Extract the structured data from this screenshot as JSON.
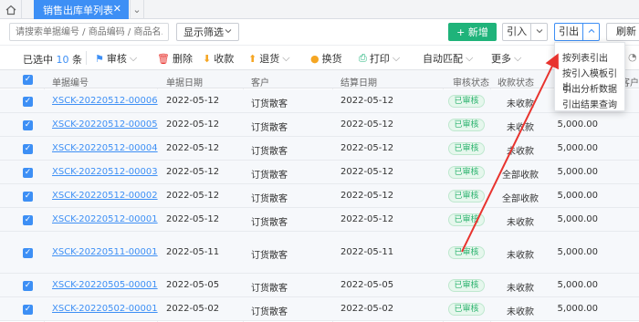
{
  "tabbar": {
    "tab_label": "销售出库单列表",
    "close": "✕",
    "more": "⌄"
  },
  "search": {
    "placeholder": "请搜索单据编号 / 商品编码 / 商品名..."
  },
  "toolbar": {
    "filter": "显示筛选",
    "new": "+ 新增",
    "import": "引入",
    "export": "引出",
    "refresh": "刷新"
  },
  "actions": {
    "selected_prefix": "已选中",
    "selected_count": "10",
    "selected_suffix": "条",
    "audit": "审核",
    "delete": "删除",
    "collect": "收款",
    "return": "退货",
    "exchange": "换货",
    "print": "打印",
    "auto_match": "自动匹配",
    "more": "更多"
  },
  "columns": [
    "单据编号",
    "单据日期",
    "客户",
    "结算日期",
    "审核状态",
    "收款状态",
    "客户"
  ],
  "rows": [
    {
      "no": "XSCK-20220512-00006",
      "date": "2022-05-12",
      "customer": "订货散客",
      "settle": "2022-05-12",
      "audit": "已审核",
      "pay": "未收款",
      "amount": "5,000.00"
    },
    {
      "no": "XSCK-20220512-00005",
      "date": "2022-05-12",
      "customer": "订货散客",
      "settle": "2022-05-12",
      "audit": "已审核",
      "pay": "未收款",
      "amount": "5,000.00"
    },
    {
      "no": "XSCK-20220512-00004",
      "date": "2022-05-12",
      "customer": "订货散客",
      "settle": "2022-05-12",
      "audit": "已审核",
      "pay": "未收款",
      "amount": "5,000.00"
    },
    {
      "no": "XSCK-20220512-00003",
      "date": "2022-05-12",
      "customer": "订货散客",
      "settle": "2022-05-12",
      "audit": "已审核",
      "pay": "全部收款",
      "amount": "5,000.00"
    },
    {
      "no": "XSCK-20220512-00002",
      "date": "2022-05-12",
      "customer": "订货散客",
      "settle": "2022-05-12",
      "audit": "已审核",
      "pay": "全部收款",
      "amount": "5,000.00"
    },
    {
      "no": "XSCK-20220512-00001",
      "date": "2022-05-12",
      "customer": "订货散客",
      "settle": "2022-05-12",
      "audit": "已审核",
      "pay": "未收款",
      "amount": "5,000.00"
    },
    {
      "no": "XSCK-20220511-00001",
      "date": "2022-05-11",
      "customer": "订货散客",
      "settle": "2022-05-11",
      "audit": "已审核",
      "pay": "未收款",
      "amount": "5,000.00"
    },
    {
      "no": "XSCK-20220505-00001",
      "date": "2022-05-05",
      "customer": "订货散客",
      "settle": "2022-05-05",
      "audit": "已审核",
      "pay": "未收款",
      "amount": "5,000.00"
    },
    {
      "no": "XSCK-20220502-00001",
      "date": "2022-05-02",
      "customer": "订货散客",
      "settle": "2022-05-02",
      "audit": "已审核",
      "pay": "未收款",
      "amount": "5,000.00"
    }
  ],
  "export_menu": [
    "按列表引出",
    "按引入模板引出",
    "引出分析数据",
    "引出结果查询"
  ],
  "colors": {
    "accent": "#3d8ff5",
    "new": "#1fb37a",
    "arrow": "#e8332e"
  }
}
